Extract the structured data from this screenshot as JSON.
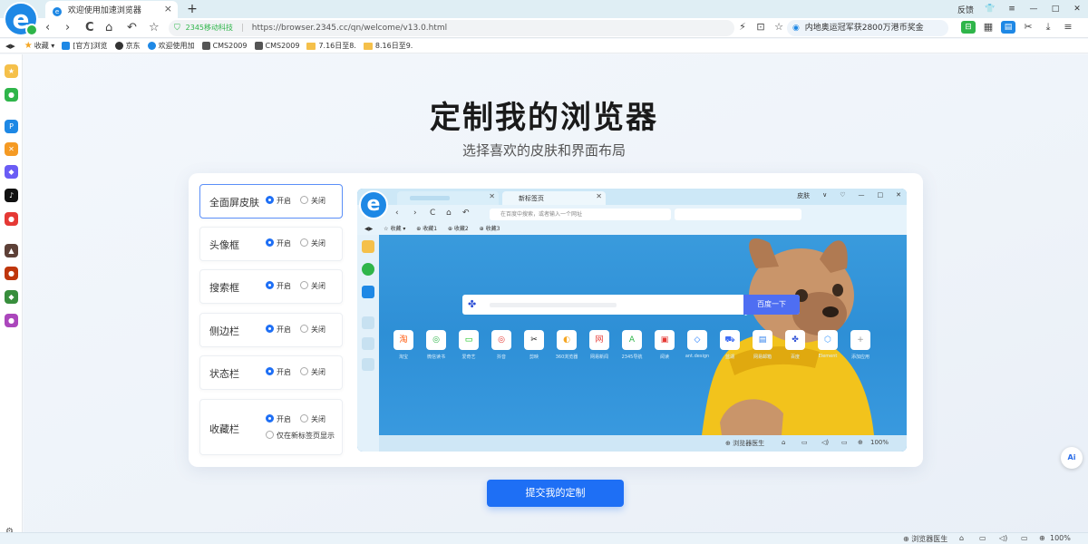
{
  "window": {
    "tab_title": "欢迎使用加速浏览器",
    "tab_close": "×",
    "new_tab": "+",
    "logo_letter": "e",
    "top_right": {
      "feedback": "反馈",
      "skin_icon": "shirt-icon",
      "menu_icon": "≡",
      "minimize": "—",
      "maximize": "□",
      "close": "✕"
    }
  },
  "toolbar": {
    "back": "‹",
    "forward": "›",
    "refresh": "C",
    "home": "⌂",
    "undo": "↶",
    "fav": "☆",
    "address": {
      "org": "2345移动科技",
      "separator": "|",
      "url": "https://browser.2345.cc/qn/welcome/v13.0.html"
    },
    "news": "内地奥运冠军获2800万港币奖金",
    "icons": [
      "⚡",
      "⊡",
      "☆"
    ],
    "ext_icons": [
      "⊟",
      "▦",
      "▤",
      "✂",
      "⤓",
      "≡"
    ]
  },
  "bookmarks": {
    "collapse": "◀▶",
    "items": [
      {
        "label": "收藏",
        "kind": "star"
      },
      {
        "label": "[官方]浏览",
        "kind": "blue"
      },
      {
        "label": "京东",
        "kind": "dark"
      },
      {
        "label": "欢迎使用加",
        "kind": "blue"
      },
      {
        "label": "CMS2009",
        "kind": "gray"
      },
      {
        "label": "CMS2009",
        "kind": "gray"
      },
      {
        "label": "7.16日至8.",
        "kind": "folder"
      },
      {
        "label": "8.16日至9.",
        "kind": "folder"
      }
    ]
  },
  "sidebar": {
    "items": [
      {
        "name": "star",
        "color": "#f5c04a",
        "glyph": "★"
      },
      {
        "name": "wechat",
        "color": "#2fb54a",
        "glyph": "●"
      },
      {
        "name": "p",
        "color": "#1e88e5",
        "glyph": "P"
      },
      {
        "name": "tools",
        "color": "#f59a23",
        "glyph": "✕"
      },
      {
        "name": "game",
        "color": "#6a5cf5",
        "glyph": "◆"
      },
      {
        "name": "tiktok",
        "color": "#111111",
        "glyph": "♪"
      },
      {
        "name": "shop",
        "color": "#e53935",
        "glyph": "●"
      },
      {
        "name": "game2",
        "color": "#5d4037",
        "glyph": "▲"
      },
      {
        "name": "game3",
        "color": "#bf360c",
        "glyph": "●"
      },
      {
        "name": "game4",
        "color": "#388e3c",
        "glyph": "◆"
      },
      {
        "name": "game5",
        "color": "#ab47bc",
        "glyph": "●"
      }
    ],
    "bottom_icon": "⚙"
  },
  "main": {
    "title": "定制我的浏览器",
    "subtitle": "选择喜欢的皮肤和界面布局",
    "options": [
      {
        "label": "全面屏皮肤",
        "on": "开启",
        "off": "关闭",
        "selected": "on",
        "active": true
      },
      {
        "label": "头像框",
        "on": "开启",
        "off": "关闭",
        "selected": "on",
        "active": false
      },
      {
        "label": "搜索框",
        "on": "开启",
        "off": "关闭",
        "selected": "on",
        "active": false
      },
      {
        "label": "侧边栏",
        "on": "开启",
        "off": "关闭",
        "selected": "on",
        "active": false
      },
      {
        "label": "状态栏",
        "on": "开启",
        "off": "关闭",
        "selected": "on",
        "active": false
      },
      {
        "label": "收藏栏",
        "on": "开启",
        "off": "关闭",
        "extra": "仅在新标签页显示",
        "selected": "on",
        "active": false
      }
    ],
    "submit": "提交我的定制"
  },
  "preview": {
    "logo_letter": "e",
    "tab2": "新标签页",
    "top_right": [
      "皮肤",
      "∨",
      "♡",
      "—",
      "□",
      "✕"
    ],
    "address_placeholder": "在百度中搜索，或者输入一个网址",
    "bookmarks": [
      "◀▶",
      "☆ 收藏 ▾",
      "⊕ 收藏1",
      "⊕ 收藏2",
      "⊕ 收藏3"
    ],
    "search_button": "百度一下",
    "apps": [
      {
        "label": "淘宝",
        "color": "#ff5000",
        "glyph": "淘"
      },
      {
        "label": "微信读书",
        "color": "#2fb54a",
        "glyph": "◎"
      },
      {
        "label": "爱奇艺",
        "color": "#00be06",
        "glyph": "▭"
      },
      {
        "label": "抖音",
        "color": "#e53935",
        "glyph": "◎"
      },
      {
        "label": "剪映",
        "color": "#111111",
        "glyph": "✂"
      },
      {
        "label": "360浏览器",
        "color": "#f5a623",
        "glyph": "◐"
      },
      {
        "label": "网易新闻",
        "color": "#e53935",
        "glyph": "网"
      },
      {
        "label": "2345导航",
        "color": "#2fb54a",
        "glyph": "A"
      },
      {
        "label": "阅读",
        "color": "#e53935",
        "glyph": "▣"
      },
      {
        "label": "ant.design",
        "color": "#1677ff",
        "glyph": "◇"
      },
      {
        "label": "蓝湖",
        "color": "#3f6ef5",
        "glyph": "⛟"
      },
      {
        "label": "网易邮箱",
        "color": "#2f80ed",
        "glyph": "▤"
      },
      {
        "label": "百度",
        "color": "#2d4fd6",
        "glyph": "✤"
      },
      {
        "label": "Element",
        "color": "#409eff",
        "glyph": "⬡"
      },
      {
        "label": "添加应用",
        "color": "#999999",
        "glyph": "+"
      }
    ],
    "status": {
      "doctor": "浏览器医生",
      "zoom": "100%"
    }
  },
  "ai_button": "Ai",
  "statusbar": {
    "doctor": "浏览器医生",
    "zoom": "100%",
    "icons": [
      "⌂",
      "▭",
      "◁)",
      "▭"
    ]
  }
}
